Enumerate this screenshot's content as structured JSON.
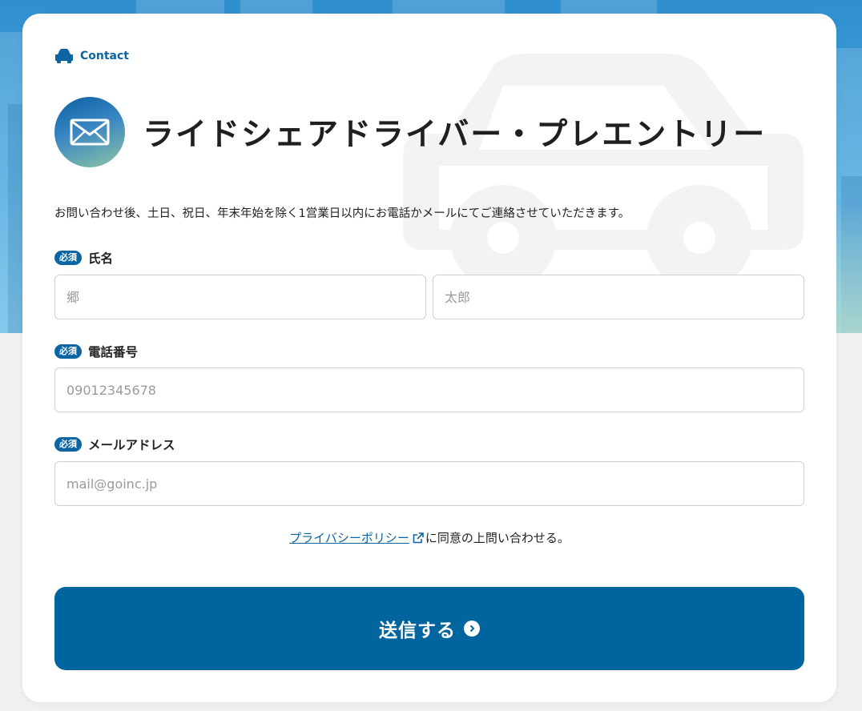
{
  "header": {
    "eyebrow_icon": "car-icon",
    "eyebrow_label": "Contact",
    "title_icon": "envelope-icon",
    "title": "ライドシェアドライバー・プレエントリー",
    "description": "お問い合わせ後、土日、祝日、年末年始を除く1営業日以内にお電話かメールにてご連絡させていただきます。"
  },
  "form": {
    "required_badge": "必須",
    "name": {
      "label": "氏名",
      "last_placeholder": "郷",
      "first_placeholder": "太郎"
    },
    "phone": {
      "label": "電話番号",
      "placeholder": "09012345678"
    },
    "email": {
      "label": "メールアドレス",
      "placeholder": "mail@goinc.jp"
    },
    "consent": {
      "link_text": "プライバシーポリシー",
      "link_icon": "external-link-icon",
      "suffix": "に同意の上問い合わせる。"
    },
    "submit": {
      "label": "送信する",
      "icon": "chevron-right-circle-icon"
    }
  },
  "colors": {
    "accent": "#00659e",
    "link": "#0b65a3",
    "page_background": "#f1f1f1",
    "header_background": "#4aa8dd"
  }
}
